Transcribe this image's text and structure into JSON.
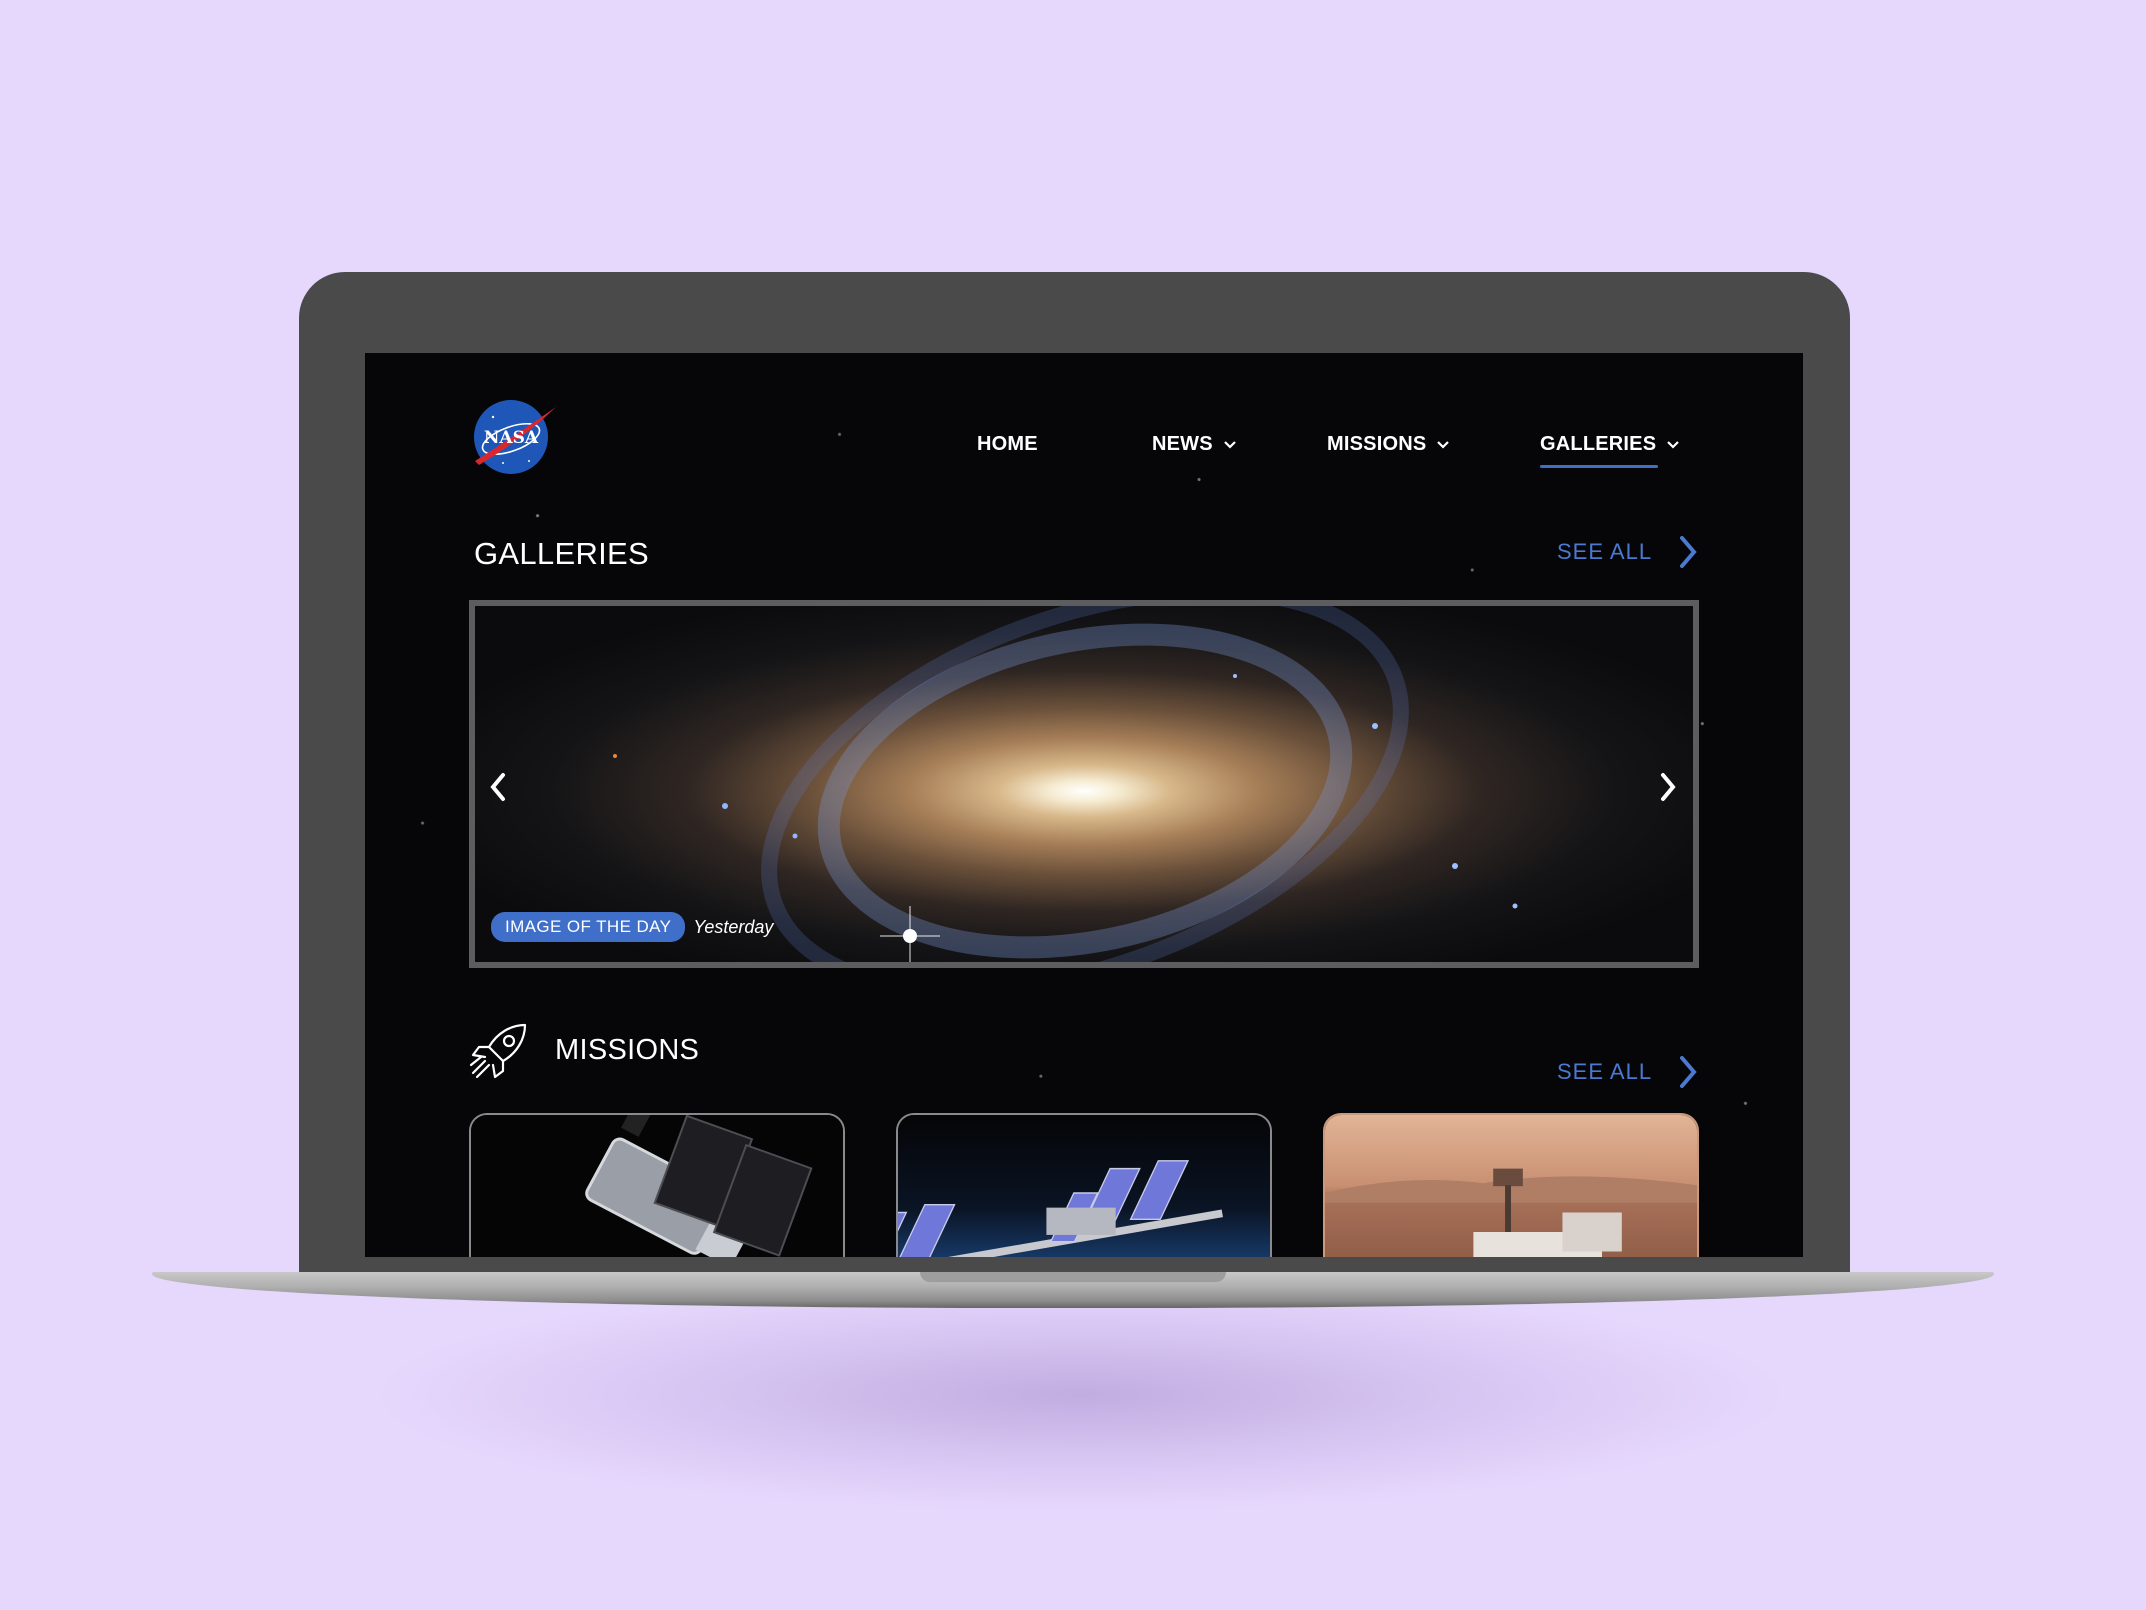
{
  "nav": {
    "logo_text": "NASA",
    "items": [
      {
        "label": "HOME",
        "has_dropdown": false,
        "active": false
      },
      {
        "label": "NEWS",
        "has_dropdown": true,
        "active": false
      },
      {
        "label": "MISSIONS",
        "has_dropdown": true,
        "active": false
      },
      {
        "label": "GALLERIES",
        "has_dropdown": true,
        "active": true
      }
    ]
  },
  "galleries": {
    "title": "GALLERIES",
    "see_all": "SEE ALL",
    "badge": "IMAGE OF THE DAY",
    "time": "Yesterday"
  },
  "missions": {
    "title": "MISSIONS",
    "see_all": "SEE ALL",
    "cards": [
      "Hubble Space Telescope",
      "International Space Station",
      "Mars rover"
    ]
  },
  "colors": {
    "background": "#e6d8fd",
    "accent": "#3f6fc9",
    "link": "#4b79d1",
    "screen": "#060608",
    "device": "#4a4a4a"
  }
}
